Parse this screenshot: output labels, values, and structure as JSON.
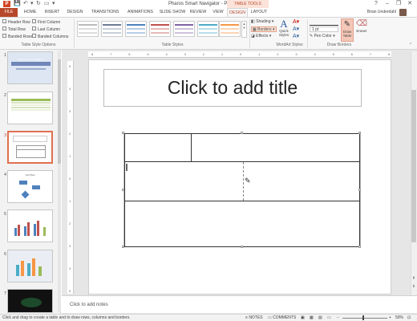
{
  "titlebar": {
    "app_icon": "P",
    "title": "Pharos Smart Navigator - PowerPoint",
    "contextual_label": "TABLE TOOLS",
    "controls": [
      "?",
      "–",
      "❐",
      "✕"
    ]
  },
  "tabs": [
    "FILE",
    "HOME",
    "INSERT",
    "DESIGN",
    "TRANSITIONS",
    "ANIMATIONS",
    "SLIDE SHOW",
    "REVIEW",
    "VIEW",
    "DESIGN",
    "LAYOUT"
  ],
  "active_tab_index": 9,
  "user": {
    "name": "Brian Underdahl"
  },
  "ribbon": {
    "table_style_options": {
      "label": "Table Style Options",
      "options": [
        {
          "label": "Header Row",
          "checked": false
        },
        {
          "label": "First Column",
          "checked": false
        },
        {
          "label": "Total Row",
          "checked": false
        },
        {
          "label": "Last Column",
          "checked": false
        },
        {
          "label": "Banded Rows",
          "checked": false
        },
        {
          "label": "Banded Columns",
          "checked": false
        }
      ]
    },
    "table_styles": {
      "label": "Table Styles"
    },
    "wordart": {
      "label": "WordArt Styles",
      "shading": "Shading",
      "borders": "Borders",
      "effects": "Effects",
      "quick_styles": "Quick Styles"
    },
    "draw_borders": {
      "label": "Draw Borders",
      "pen_weight": "1 pt",
      "pen_color": "Pen Color",
      "draw_table": "Draw Table",
      "eraser": "Eraser"
    }
  },
  "slides": [
    {
      "number": "1",
      "title": "Pharos Smart Navigator"
    },
    {
      "number": "2"
    },
    {
      "number": "3"
    },
    {
      "number": "4",
      "title": "Our Plan"
    },
    {
      "number": "5"
    },
    {
      "number": "6"
    },
    {
      "number": "7"
    }
  ],
  "selected_slide": 3,
  "slide": {
    "title_placeholder": "Click to add title"
  },
  "ruler_h": [
    "8",
    "7",
    "6",
    "5",
    "4",
    "3",
    "2",
    "1",
    "0",
    "1",
    "2",
    "3",
    "4",
    "5",
    "6",
    "7",
    "8"
  ],
  "ruler_v": [
    "5",
    "4",
    "3",
    "2",
    "1",
    "0",
    "1",
    "2",
    "3",
    "4",
    "5"
  ],
  "notes": {
    "placeholder": "Click to add notes"
  },
  "status": {
    "message": "Click and drag to create a table and to draw rows, columns and borders.",
    "notes_btn": "NOTES",
    "comments_btn": "COMMENTS",
    "zoom": "59%"
  },
  "colors": {
    "accent": "#b7472a",
    "ribbon_bg": "#f7f7f7",
    "pane_bg": "#f2f2f2",
    "edit_bg": "#e6e6e6",
    "selected_thumb": "#e07050"
  }
}
